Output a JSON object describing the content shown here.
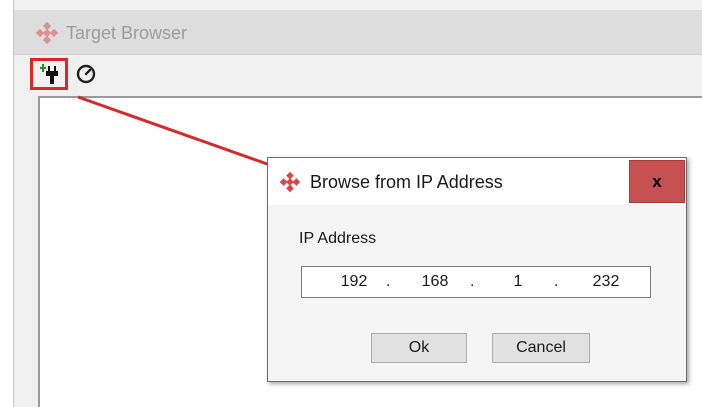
{
  "target_browser": {
    "title": "Target Browser",
    "toolbar": {
      "browse_ip_button_icon": "add-plug-icon",
      "scan_button_icon": "refresh-clock-icon",
      "highlight_color": "#d42a2a"
    }
  },
  "dialog": {
    "title": "Browse from IP Address",
    "close_label": "x",
    "ip_label": "IP Address",
    "ip_octets": [
      "192",
      "168",
      "1",
      "232"
    ],
    "ok_label": "Ok",
    "cancel_label": "Cancel",
    "close_color": "#c75050"
  },
  "icons": {
    "app_logo": "red-diamond-logo-icon"
  }
}
